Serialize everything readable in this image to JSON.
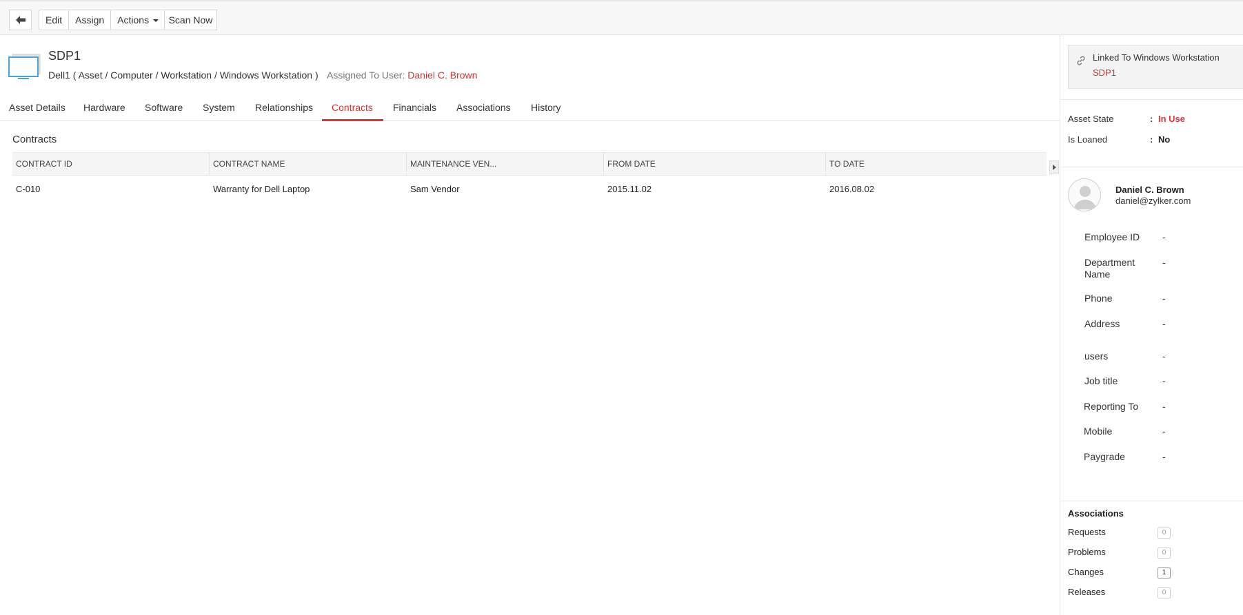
{
  "toolbar": {
    "back_icon": "arrow-left-icon",
    "edit": "Edit",
    "assign": "Assign",
    "actions": "Actions",
    "scan_now": "Scan Now"
  },
  "asset": {
    "icon": "monitor-icon",
    "name": "SDP1",
    "path": "Dell1 ( Asset / Computer / Workstation / Windows Workstation )",
    "assigned_label": "Assigned To User:",
    "assigned_user": "Daniel C. Brown"
  },
  "tabs": [
    {
      "label": "Asset Details"
    },
    {
      "label": "Hardware"
    },
    {
      "label": "Software"
    },
    {
      "label": "System"
    },
    {
      "label": "Relationships"
    },
    {
      "label": "Contracts",
      "active": true
    },
    {
      "label": "Financials"
    },
    {
      "label": "Associations"
    },
    {
      "label": "History"
    }
  ],
  "contracts": {
    "title": "Contracts",
    "columns": [
      "CONTRACT ID",
      "CONTRACT NAME",
      "MAINTENANCE VEN...",
      "FROM DATE",
      "TO DATE"
    ],
    "rows": [
      {
        "contract_id": "C-010",
        "contract_name": "Warranty for Dell Laptop",
        "vendor": "Sam Vendor",
        "from_date": "2015.11.02",
        "to_date": "2016.08.02"
      }
    ]
  },
  "sidebar": {
    "linked_label": "Linked To Windows Workstation",
    "linked_value": "SDP1",
    "asset_state_label": "Asset State",
    "asset_state_value": "In Use",
    "is_loaned_label": "Is Loaned",
    "is_loaned_value": "No",
    "colon": ":",
    "user": {
      "name": "Daniel C. Brown",
      "email": "daniel@zylker.com"
    },
    "user_details": [
      {
        "label": "Employee ID",
        "value": "-"
      },
      {
        "label": "Department Name",
        "value": "-"
      },
      {
        "label": "Phone",
        "value": "-"
      },
      {
        "label": "Address",
        "value": "-"
      },
      {
        "label": "users",
        "value": "-"
      },
      {
        "label": "Job title",
        "value": "-"
      },
      {
        "label": "Reporting To",
        "value": "-"
      },
      {
        "label": "Mobile",
        "value": "-"
      },
      {
        "label": "Paygrade",
        "value": "-"
      }
    ],
    "associations": {
      "title": "Associations",
      "items": [
        {
          "label": "Requests",
          "count": "0"
        },
        {
          "label": "Problems",
          "count": "0"
        },
        {
          "label": "Changes",
          "count": "1"
        },
        {
          "label": "Releases",
          "count": "0"
        }
      ]
    }
  },
  "colors": {
    "accent": "#dd3333",
    "link": "#cc3333"
  }
}
